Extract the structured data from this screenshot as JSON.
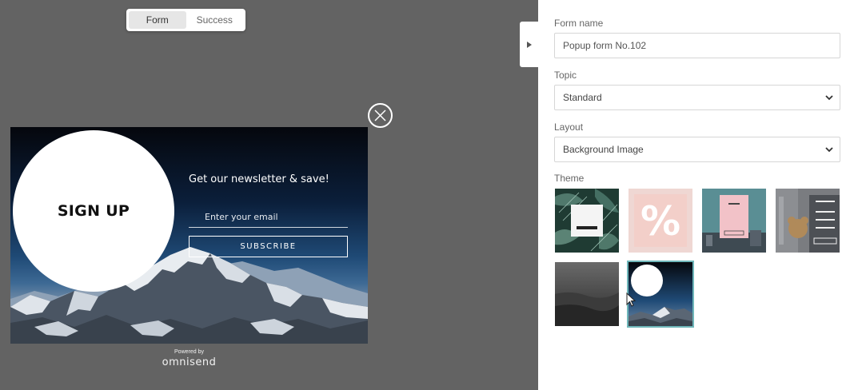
{
  "view_toggle": {
    "form": "Form",
    "success": "Success"
  },
  "popup": {
    "circle_text": "SIGN UP",
    "heading": "Get our newsletter & save!",
    "email_placeholder": "Enter your email",
    "subscribe_label": "SUBSCRIBE",
    "powered_by": "Powered by",
    "brand": "omnisend"
  },
  "settings": {
    "form_name_label": "Form name",
    "form_name_value": "Popup form No.102",
    "topic_label": "Topic",
    "topic_value": "Standard",
    "layout_label": "Layout",
    "layout_value": "Background Image",
    "theme_label": "Theme",
    "themes": [
      {
        "name": "leaf-theme",
        "glyph": ""
      },
      {
        "name": "percent-theme",
        "glyph": "%"
      },
      {
        "name": "pink-card-theme",
        "glyph": ""
      },
      {
        "name": "bear-theme",
        "glyph": ""
      },
      {
        "name": "dark-sea-theme",
        "glyph": ""
      },
      {
        "name": "mountain-circle-theme",
        "glyph": ""
      }
    ],
    "selected_theme": 5
  },
  "colors": {
    "canvas": "#636363",
    "selection": "#6fb7ba"
  }
}
